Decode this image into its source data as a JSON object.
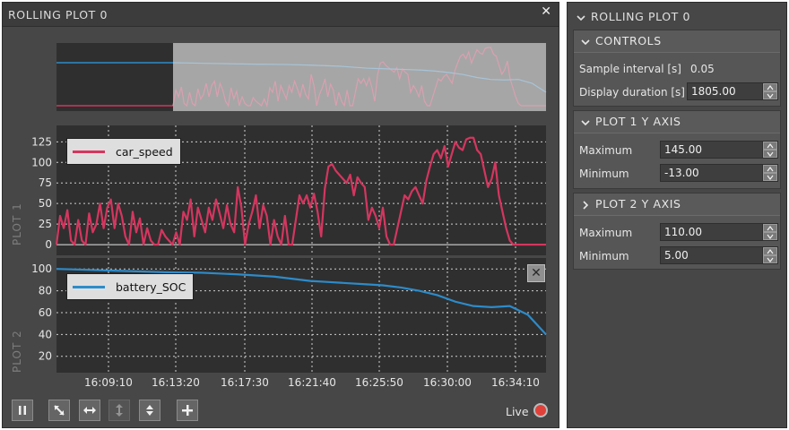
{
  "window": {
    "title": "ROLLING PLOT 0",
    "close_icon": "close-icon"
  },
  "colors": {
    "car_speed": "#d4365f",
    "battery_SOC": "#2d8bc9",
    "plot_bg": "#2f2f2f",
    "preview_shade": "#a6a6a6",
    "live_indicator": "#e0413a"
  },
  "plots": {
    "plot1_label": "PLOT 1",
    "plot2_label": "PLOT 2",
    "remove_plot_icon": "close-icon"
  },
  "chart_data": [
    {
      "type": "line",
      "name": "plot-1",
      "x_ticks": [
        "16:09:10",
        "16:13:20",
        "16:17:30",
        "16:21:40",
        "16:25:50",
        "16:30:00",
        "16:34:10"
      ],
      "y_ticks": [
        0,
        25,
        50,
        75,
        100,
        125
      ],
      "ylim": [
        -13,
        145
      ],
      "legend": "top-left",
      "grid": true,
      "series": [
        {
          "name": "car_speed",
          "color": "#d4365f",
          "x": [
            0,
            4,
            8,
            12,
            16,
            20,
            24,
            28,
            32,
            36,
            40,
            44,
            48,
            52,
            56,
            60,
            64,
            68,
            72,
            76,
            80,
            84,
            88,
            92,
            96,
            100,
            104,
            108,
            112,
            116,
            120,
            124,
            128,
            132,
            136,
            140,
            144,
            148,
            152,
            156,
            160,
            164,
            168,
            172,
            176,
            180,
            184,
            188,
            192,
            196,
            200,
            204,
            208,
            212,
            216,
            220,
            224,
            228,
            232,
            236,
            240,
            244,
            248,
            252,
            256,
            260,
            264,
            268,
            272,
            276,
            280,
            284,
            288,
            292,
            296,
            300,
            304,
            308,
            312,
            316,
            320,
            324,
            328,
            332,
            336,
            340,
            344,
            348,
            352,
            356,
            360,
            364,
            368,
            372,
            376,
            380,
            384,
            388,
            392,
            396,
            400,
            404,
            408,
            412,
            416,
            420,
            424,
            428,
            432,
            436,
            440,
            444,
            448,
            452,
            456,
            460,
            464,
            468,
            472,
            476,
            480,
            484,
            488,
            492,
            496,
            500,
            504,
            508,
            512,
            516,
            520,
            524,
            528,
            532,
            536,
            540
          ],
          "y": [
            0,
            35,
            20,
            42,
            5,
            0,
            30,
            5,
            0,
            38,
            15,
            25,
            50,
            20,
            45,
            55,
            20,
            50,
            35,
            10,
            0,
            40,
            15,
            32,
            0,
            20,
            5,
            0,
            0,
            18,
            10,
            5,
            0,
            15,
            0,
            40,
            30,
            55,
            10,
            45,
            30,
            15,
            45,
            30,
            55,
            38,
            20,
            48,
            25,
            15,
            70,
            45,
            0,
            25,
            40,
            60,
            20,
            48,
            35,
            0,
            30,
            10,
            0,
            35,
            0,
            0,
            30,
            60,
            50,
            60,
            45,
            62,
            40,
            10,
            68,
            95,
            98,
            90,
            85,
            80,
            75,
            85,
            60,
            82,
            75,
            70,
            30,
            45,
            35,
            20,
            45,
            10,
            0,
            0,
            20,
            40,
            60,
            55,
            65,
            70,
            60,
            50,
            78,
            95,
            110,
            115,
            105,
            120,
            95,
            110,
            125,
            118,
            115,
            128,
            130,
            130,
            115,
            110,
            90,
            70,
            80,
            100,
            60,
            40,
            20,
            5,
            0,
            0,
            0,
            0,
            0,
            0,
            0,
            0,
            0,
            0
          ]
        }
      ]
    },
    {
      "type": "line",
      "name": "plot-2",
      "y_ticks": [
        20,
        40,
        60,
        80,
        100
      ],
      "ylim": [
        5,
        110
      ],
      "legend": "top-left",
      "grid": true,
      "series": [
        {
          "name": "battery_SOC",
          "color": "#2d8bc9",
          "x": [
            0,
            40,
            80,
            120,
            160,
            200,
            240,
            280,
            300,
            320,
            340,
            360,
            380,
            400,
            420,
            440,
            460,
            480,
            500,
            520,
            540
          ],
          "y": [
            100,
            99,
            98,
            97,
            96.5,
            95,
            93,
            89,
            88,
            87,
            86,
            85,
            83,
            80,
            76,
            70,
            66,
            65,
            66,
            58,
            40
          ]
        }
      ]
    }
  ],
  "toolbar": {
    "pause_icon": "pause-icon",
    "fit_icon": "fit-diagonal-icon",
    "fit_x_icon": "fit-horizontal-icon",
    "fit_y_icon": "fit-vertical-icon",
    "autoscale_icon": "autoscale-icon",
    "add_icon": "plus-icon",
    "live_label": "Live"
  },
  "panel": {
    "header": "ROLLING PLOT 0",
    "controls": {
      "title": "CONTROLS",
      "sample_interval_label": "Sample interval [s]",
      "sample_interval_value": "0.05",
      "display_duration_label": "Display duration [s]",
      "display_duration_value": "1805.00"
    },
    "plot1_axis": {
      "title": "PLOT 1 Y AXIS",
      "max_label": "Maximum",
      "max_value": "145.00",
      "min_label": "Minimum",
      "min_value": "-13.00"
    },
    "plot2_axis": {
      "title": "PLOT 2 Y AXIS",
      "max_label": "Maximum",
      "max_value": "110.00",
      "min_label": "Minimum",
      "min_value": "5.00"
    }
  }
}
